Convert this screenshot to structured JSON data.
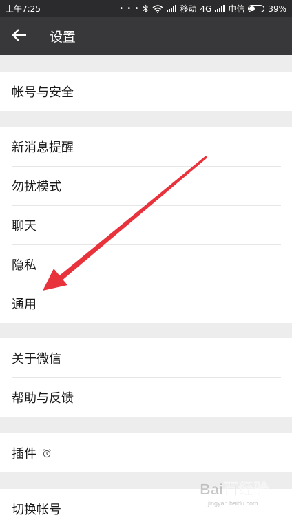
{
  "status_bar": {
    "time": "上午7:25",
    "dots": "• • •",
    "carrier1": "移动",
    "network": "4G",
    "carrier2": "电信",
    "battery": "39%",
    "battery_level": 0.39
  },
  "header": {
    "title": "设置"
  },
  "groups": {
    "account": {
      "items": [
        "帐号与安全"
      ]
    },
    "settings": {
      "items": [
        "新消息提醒",
        "勿扰模式",
        "聊天",
        "隐私",
        "通用"
      ]
    },
    "about": {
      "items": [
        "关于微信",
        "帮助与反馈"
      ]
    },
    "plugins": {
      "items": [
        "插件"
      ]
    },
    "switch": {
      "items": [
        "切换帐号"
      ]
    }
  },
  "annotation": {
    "color": "#e8323c"
  },
  "watermark": {
    "text": "Bai百经验",
    "sub": "jingyan.baidu.com"
  }
}
